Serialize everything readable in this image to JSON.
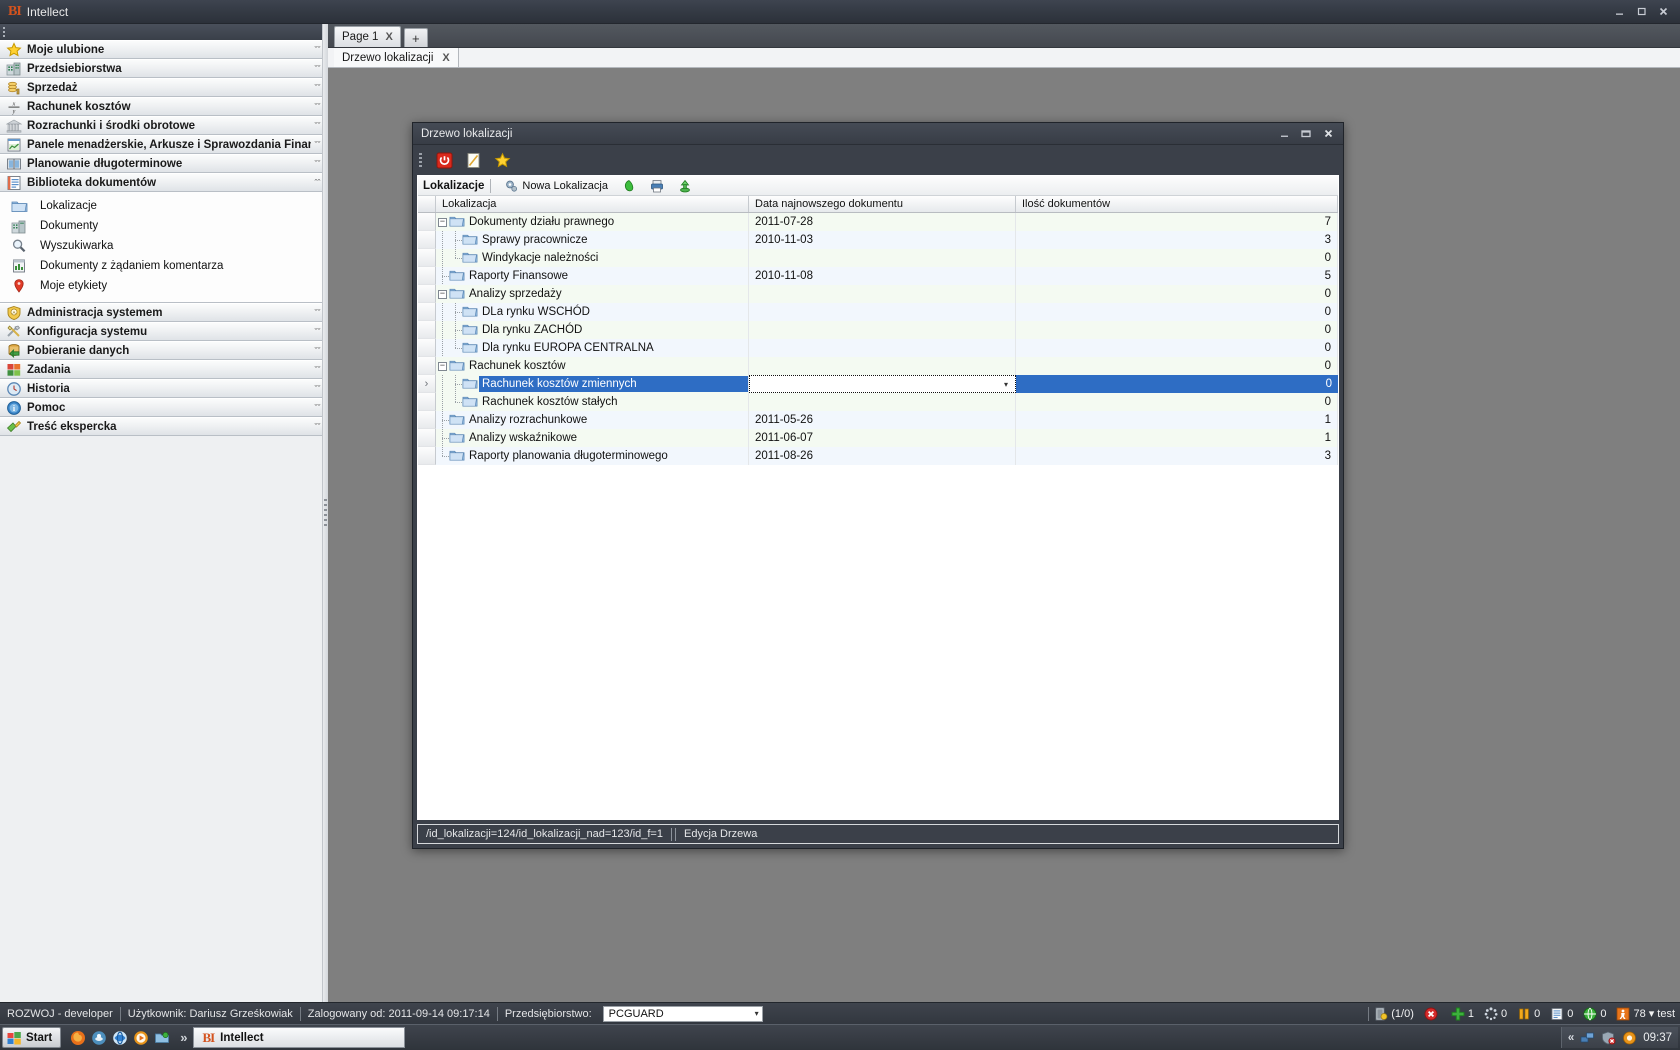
{
  "window": {
    "title": "Intellect",
    "logo": "bi-logo",
    "minimize": "_",
    "restore": "❐",
    "close": "X"
  },
  "sidebar": {
    "groups": [
      {
        "label": "Moje ulubione",
        "icon": "star-icon",
        "expanded": false
      },
      {
        "label": "Przedsiebiorstwa",
        "icon": "buildings-icon",
        "expanded": false
      },
      {
        "label": "Sprzedaż",
        "icon": "coins-icon",
        "expanded": false
      },
      {
        "label": "Rachunek kosztów",
        "icon": "formula-icon",
        "expanded": false
      },
      {
        "label": "Rozrachunki i środki obrotowe",
        "icon": "bank-icon",
        "expanded": false
      },
      {
        "label": "Panele menadżerskie, Arkusze i Sprawozdania Finans",
        "icon": "chart-sheet-icon",
        "expanded": false
      },
      {
        "label": "Planowanie długoterminowe",
        "icon": "book-icon",
        "expanded": false
      },
      {
        "label": "Biblioteka dokumentów",
        "icon": "document-library-icon",
        "expanded": true
      },
      {
        "label": "Administracja systemem",
        "icon": "shield-icon",
        "expanded": false
      },
      {
        "label": "Konfiguracja systemu",
        "icon": "tools-icon",
        "expanded": false
      },
      {
        "label": "Pobieranie danych",
        "icon": "database-download-icon",
        "expanded": false
      },
      {
        "label": "Zadania",
        "icon": "tasks-icon",
        "expanded": false
      },
      {
        "label": "Historia",
        "icon": "clock-icon",
        "expanded": false
      },
      {
        "label": "Pomoc",
        "icon": "info-icon",
        "expanded": false
      },
      {
        "label": "Treść ekspercka",
        "icon": "expert-icon",
        "expanded": false
      }
    ],
    "expanded_items": [
      {
        "label": "Lokalizacje",
        "icon": "folder-icon"
      },
      {
        "label": "Dokumenty",
        "icon": "buildings-icon"
      },
      {
        "label": "Wyszukiwarka",
        "icon": "magnifier-icon"
      },
      {
        "label": "Dokumenty z żądaniem komentarza",
        "icon": "doc-comment-icon"
      },
      {
        "label": "Moje etykiety",
        "icon": "map-pin-icon"
      }
    ],
    "collapse_chevron": "ˇˇ",
    "expand_chevron": "ˆˆ"
  },
  "tabs": {
    "pages": [
      {
        "label": "Page 1",
        "close": "X",
        "active": true
      }
    ],
    "add_label": "+",
    "subtabs": [
      {
        "label": "Drzewo lokalizacji",
        "close": "X",
        "active": true
      }
    ]
  },
  "dialog": {
    "title": "Drzewo lokalizacji",
    "minimize": "_",
    "restore": "▭",
    "close": "X",
    "toolbar": [
      {
        "name": "power-icon",
        "title": "power"
      },
      {
        "name": "edit-note-icon",
        "title": "edit"
      },
      {
        "name": "star-icon",
        "title": "favourite"
      }
    ],
    "grid_toolbar": {
      "title": "Lokalizacje",
      "new_location": "Nowa Lokalizacja",
      "new_location_icon": "gear-plus-icon",
      "buttons": [
        {
          "name": "green-leaf-icon"
        },
        {
          "name": "printer-icon"
        },
        {
          "name": "green-export-icon"
        }
      ]
    },
    "columns": [
      {
        "key": "loc",
        "label": "Lokalizacja"
      },
      {
        "key": "date",
        "label": "Data najnowszego dokumentu"
      },
      {
        "key": "cnt",
        "label": "Ilość dokumentów"
      }
    ],
    "rows": [
      {
        "label": "Dokumenty działu prawnego",
        "date": "2011-07-28",
        "count": "7",
        "level": 0,
        "twisty": "minus",
        "last": false
      },
      {
        "label": "Sprawy pracownicze",
        "date": "2010-11-03",
        "count": "3",
        "level": 1,
        "twisty": "none",
        "last": false
      },
      {
        "label": "Windykacje należności",
        "date": "",
        "count": "0",
        "level": 1,
        "twisty": "none",
        "last": true
      },
      {
        "label": "Raporty Finansowe",
        "date": "2010-11-08",
        "count": "5",
        "level": 0,
        "twisty": "leaf",
        "last": false
      },
      {
        "label": "Analizy sprzedaży",
        "date": "",
        "count": "0",
        "level": 0,
        "twisty": "minus",
        "last": false
      },
      {
        "label": "DLa rynku WSCHÓD",
        "date": "",
        "count": "0",
        "level": 1,
        "twisty": "none",
        "last": false
      },
      {
        "label": "Dla rynku ZACHÓD",
        "date": "",
        "count": "0",
        "level": 1,
        "twisty": "none",
        "last": false
      },
      {
        "label": "Dla rynku EUROPA CENTRALNA",
        "date": "",
        "count": "0",
        "level": 1,
        "twisty": "none",
        "last": true
      },
      {
        "label": "Rachunek kosztów",
        "date": "",
        "count": "0",
        "level": 0,
        "twisty": "minus",
        "last": false
      },
      {
        "label": "Rachunek kosztów zmiennych",
        "date": "",
        "count": "0",
        "level": 1,
        "twisty": "none",
        "last": false,
        "selected": true,
        "editing": true
      },
      {
        "label": "Rachunek kosztów stałych",
        "date": "",
        "count": "0",
        "level": 1,
        "twisty": "none",
        "last": true
      },
      {
        "label": "Analizy rozrachunkowe",
        "date": "2011-05-26",
        "count": "1",
        "level": 0,
        "twisty": "leaf",
        "last": false
      },
      {
        "label": "Analizy wskaźnikowe",
        "date": "2011-06-07",
        "count": "1",
        "level": 0,
        "twisty": "leaf",
        "last": false
      },
      {
        "label": "Raporty planowania długoterminowego",
        "date": "2011-08-26",
        "count": "3",
        "level": 0,
        "twisty": "leaf",
        "last": true
      }
    ],
    "row_handle": "›",
    "status": {
      "path": "/id_lokalizacji=124/id_lokalizacji_nad=123/id_f=1",
      "mode": "Edycja Drzewa"
    }
  },
  "statusbar": {
    "environment": "ROZWOJ - developer",
    "user_label": "Użytkownik: Dariusz Grześkowiak",
    "login_label": "Zalogowany od: 2011-09-14 09:17:14",
    "company_label": "Przedsiębiorstwo:",
    "company_value": "PCGUARD",
    "indicators": [
      {
        "icon": "door-lock-icon",
        "value": "(1/0)"
      },
      {
        "icon": "error-icon",
        "value": ""
      },
      {
        "icon": "plus-green-icon",
        "value": "1"
      },
      {
        "icon": "spinner-icon",
        "value": "0"
      },
      {
        "icon": "pause-icon",
        "value": "0"
      },
      {
        "icon": "notes-icon",
        "value": "0"
      },
      {
        "icon": "globe-icon",
        "value": "0"
      },
      {
        "icon": "runner-icon",
        "value": "78"
      }
    ],
    "session_label": "test",
    "session_arrow": "▾"
  },
  "taskbar": {
    "start": "Start",
    "quicklaunch": [
      {
        "icon": "firefox-icon"
      },
      {
        "icon": "messenger-icon"
      },
      {
        "icon": "ie-icon"
      },
      {
        "icon": "media-player-icon"
      },
      {
        "icon": "explorer-icon"
      }
    ],
    "expand": "»",
    "task": {
      "label": "Intellect",
      "icon": "bi-logo"
    },
    "tray": {
      "chevron": "«",
      "icons": [
        {
          "icon": "network-icon"
        },
        {
          "icon": "security-alert-icon"
        },
        {
          "icon": "update-icon"
        }
      ],
      "clock": "09:37"
    }
  },
  "colors": {
    "accent": "#2e6dc4",
    "dark_chrome": "#3b4049",
    "panel_bg": "#eef0f2",
    "row_even": "#f4faf2",
    "row_odd": "#f2f7fd",
    "brand_orange": "#d4531e"
  }
}
